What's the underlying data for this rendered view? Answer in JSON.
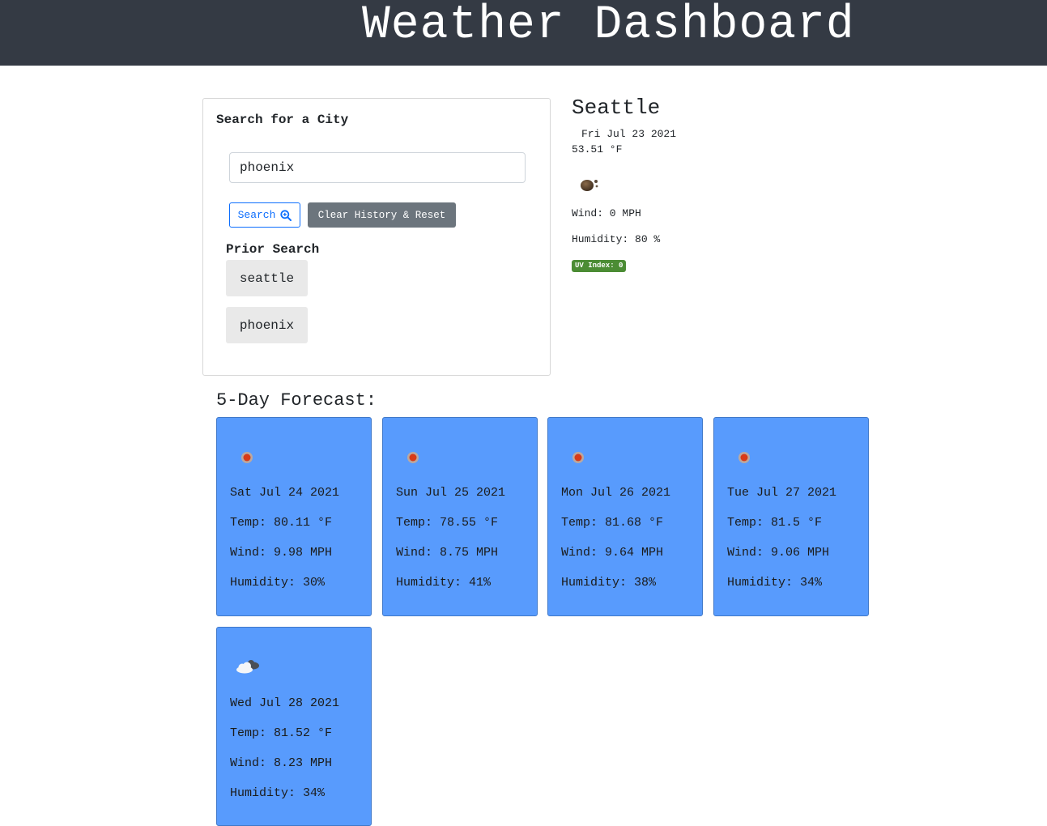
{
  "header": {
    "title": "Weather Dashboard"
  },
  "search": {
    "title": "Search for a City",
    "input_value": "phoenix",
    "search_label": "Search",
    "clear_label": "Clear History & Reset",
    "prior_title": "Prior Search",
    "history": [
      "seattle",
      "phoenix"
    ]
  },
  "current": {
    "city": "Seattle",
    "date": "Fri Jul 23 2021",
    "temp": "53.51 °F",
    "icon": "night-clouds-icon",
    "wind": "Wind: 0 MPH",
    "humidity": "Humidity: 80 %",
    "uv": "UV Index: 0",
    "uv_color": "#4b8c34"
  },
  "forecast": {
    "title": "5-Day Forecast:",
    "card_color": "#589bfd",
    "days": [
      {
        "date": "Sat Jul 24 2021",
        "temp": "Temp: 80.11 °F",
        "wind": "Wind: 9.98 MPH",
        "humidity": "Humidity: 30%",
        "icon": "sun-icon"
      },
      {
        "date": "Sun Jul 25 2021",
        "temp": "Temp: 78.55 °F",
        "wind": "Wind: 8.75 MPH",
        "humidity": "Humidity: 41%",
        "icon": "sun-icon"
      },
      {
        "date": "Mon Jul 26 2021",
        "temp": "Temp: 81.68 °F",
        "wind": "Wind: 9.64 MPH",
        "humidity": "Humidity: 38%",
        "icon": "sun-icon"
      },
      {
        "date": "Tue Jul 27 2021",
        "temp": "Temp: 81.5 °F",
        "wind": "Wind: 9.06 MPH",
        "humidity": "Humidity: 34%",
        "icon": "sun-icon"
      },
      {
        "date": "Wed Jul 28 2021",
        "temp": "Temp: 81.52 °F",
        "wind": "Wind: 8.23 MPH",
        "humidity": "Humidity: 34%",
        "icon": "cloud-icon"
      }
    ]
  }
}
